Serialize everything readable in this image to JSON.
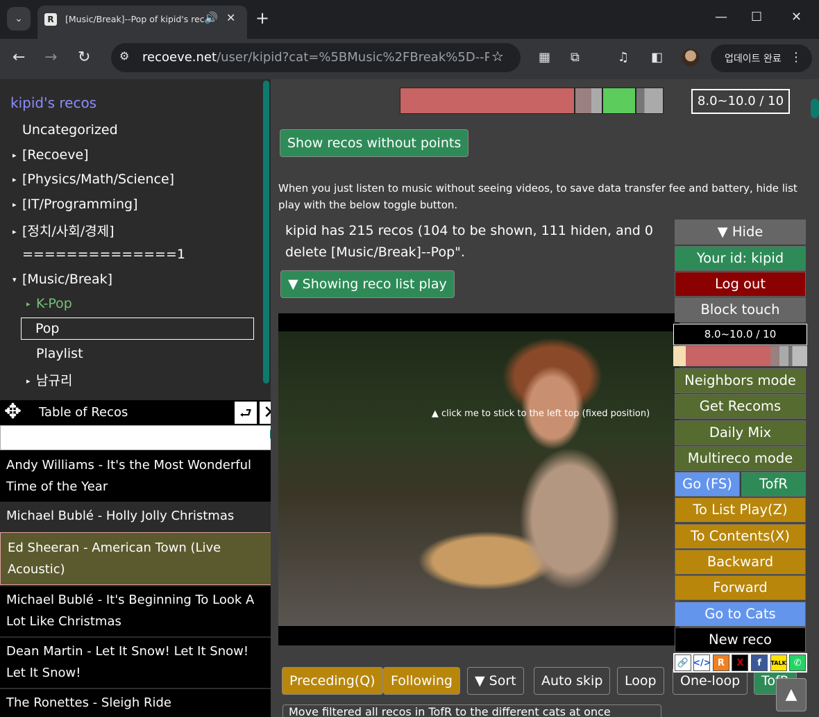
{
  "browser": {
    "tab_title": "[Music/Break]--Pop of kipid's reco",
    "tab_favicon": "R",
    "url_host": "recoeve.net",
    "url_path": "/user/kipid?cat=%5BMusic%2FBreak%5D--Pop...",
    "update_label": "업데이트 완료"
  },
  "sidebar": {
    "title": "kipid's recos",
    "items": [
      {
        "label": "Uncategorized",
        "arrow": ""
      },
      {
        "label": "[Recoeve]",
        "arrow": "▸"
      },
      {
        "label": "[Physics/Math/Science]",
        "arrow": "▸"
      },
      {
        "label": "[IT/Programming]",
        "arrow": "▸"
      },
      {
        "label": "[정치/사회/경제]",
        "arrow": "▸"
      },
      {
        "label": "==============1",
        "arrow": ""
      },
      {
        "label": "[Music/Break]",
        "arrow": "▾"
      },
      {
        "label": "K-Pop",
        "arrow": "▸"
      },
      {
        "label": "Pop",
        "arrow": ""
      },
      {
        "label": "Playlist",
        "arrow": ""
      },
      {
        "label": "남규리",
        "arrow": "▸"
      }
    ]
  },
  "toc": {
    "title": "Table of Recos",
    "items": [
      "Andy Williams - It's the Most Wonderful Time of the Year",
      "Michael Bublé - Holly Jolly Christmas",
      "Ed Sheeran - American Town (Live Acoustic)",
      "Michael Bublé - It's Beginning To Look A Lot Like Christmas",
      "Dean Martin - Let It Snow! Let It Snow! Let It Snow!",
      "The Ronettes - Sleigh Ride"
    ]
  },
  "main": {
    "range_label": "8.0~10.0 / 10",
    "show_without_points": "Show recos without points",
    "description": "When you just listen to music without seeing videos, to save data transfer fee and battery, hide list play with the below toggle button.",
    "summary": "kipid has 215 recos (104 to be shown, 111 hiden, and 0 delete [Music/Break]--Pop\".",
    "list_play_toggle": "▼ Showing reco list play",
    "video_caption": "▲ click me to stick to the left top (fixed position)",
    "controls": {
      "preceding": "Preceding(Q)",
      "following": "Following",
      "sort": "▼ Sort",
      "auto_skip": "Auto skip",
      "loop": "Loop",
      "one_loop": "One-loop",
      "tofr": "TofR"
    },
    "move_filtered": "Move filtered all recos in TofR to the different cats at once"
  },
  "right_panel": {
    "hide": "▼ Hide",
    "your_id": "Your id: kipid",
    "log_out": "Log out",
    "block_touch": "Block touch",
    "range_label": "8.0~10.0 / 10",
    "neighbors_mode": "Neighbors mode",
    "get_recoms": "Get Recoms",
    "daily_mix": "Daily Mix",
    "multireco_mode": "Multireco mode",
    "go_fs": "Go (FS)",
    "tofr": "TofR",
    "to_list_play": "To List Play(Z)",
    "to_contents": "To Contents(X)",
    "backward": "Backward",
    "forward": "Forward",
    "go_to_cats": "Go to Cats",
    "new_reco": "New reco",
    "up_arrow": "▲"
  },
  "colors": {
    "accent_green": "#2e8b57",
    "bar_red": "#c86464",
    "bar_green": "#5ccc5c",
    "gold": "#b8860b",
    "olive": "#556b2f",
    "blue": "#6495ed",
    "title_purple": "#8c8cff"
  }
}
